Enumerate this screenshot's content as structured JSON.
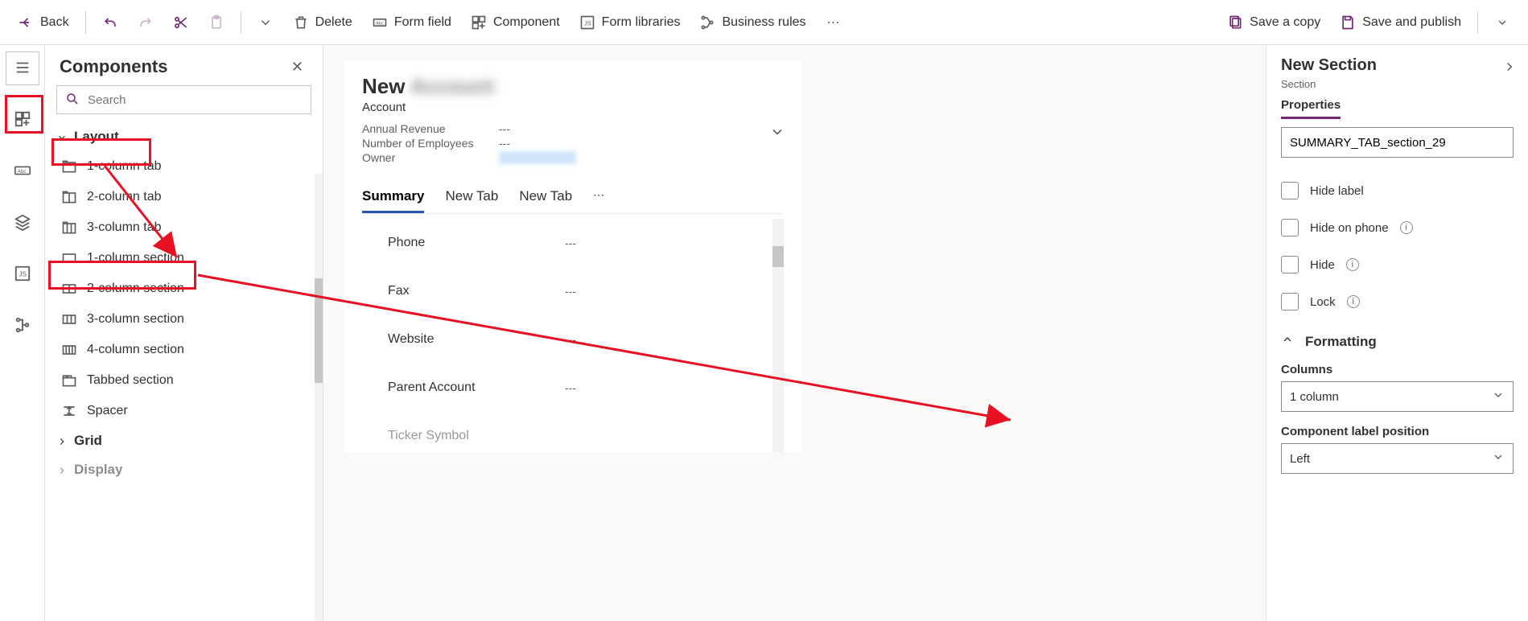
{
  "toolbar": {
    "back": "Back",
    "delete": "Delete",
    "form_field": "Form field",
    "component": "Component",
    "form_libraries": "Form libraries",
    "business_rules": "Business rules",
    "save_copy": "Save a copy",
    "save_publish": "Save and publish"
  },
  "panel": {
    "title": "Components",
    "search_placeholder": "Search",
    "groups": {
      "layout": "Layout",
      "grid": "Grid",
      "display": "Display"
    },
    "items": [
      "1-column tab",
      "2-column tab",
      "3-column tab",
      "1-column section",
      "2-column section",
      "3-column section",
      "4-column section",
      "Tabbed section",
      "Spacer"
    ]
  },
  "form": {
    "title_prefix": "New",
    "title_blur": "Account",
    "subtitle": "Account",
    "header_fields": [
      {
        "label": "Annual Revenue",
        "value": "---"
      },
      {
        "label": "Number of Employees",
        "value": "---"
      },
      {
        "label": "Owner",
        "value": ""
      }
    ],
    "tabs": [
      "Summary",
      "New Tab",
      "New Tab"
    ],
    "fields": [
      {
        "label": "Phone",
        "value": "---"
      },
      {
        "label": "Fax",
        "value": "---"
      },
      {
        "label": "Website",
        "value": "---"
      },
      {
        "label": "Parent Account",
        "value": "---"
      },
      {
        "label": "Ticker Symbol",
        "value": ""
      }
    ]
  },
  "props": {
    "title": "New Section",
    "subtitle": "Section",
    "tab": "Properties",
    "name_value": "SUMMARY_TAB_section_29",
    "checks": {
      "hide_label": "Hide label",
      "hide_phone": "Hide on phone",
      "hide": "Hide",
      "lock": "Lock"
    },
    "formatting": "Formatting",
    "columns_label": "Columns",
    "columns_value": "1 column",
    "labelpos_label": "Component label position",
    "labelpos_value": "Left"
  }
}
